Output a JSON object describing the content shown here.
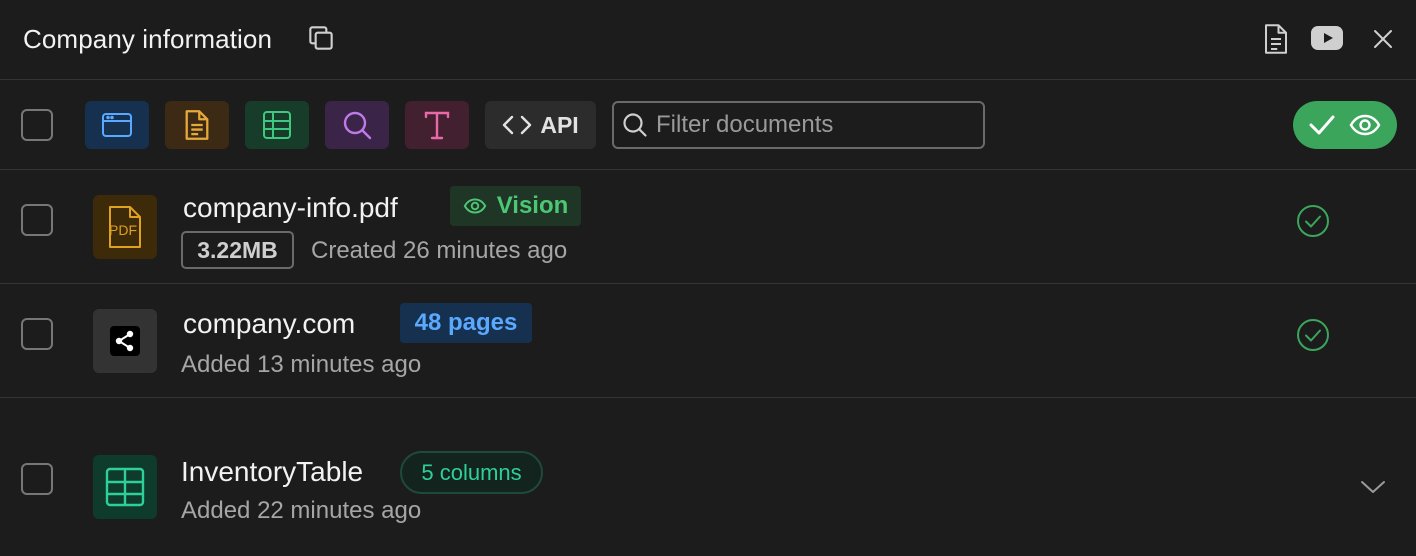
{
  "header": {
    "title": "Company information",
    "icons": [
      "copy-icon",
      "document-icon",
      "youtube-icon",
      "close-icon"
    ]
  },
  "toolbar": {
    "type_filters": [
      "browser-icon",
      "document-icon",
      "table-icon",
      "search-icon",
      "text-icon"
    ],
    "api_label": "API",
    "search_placeholder": "Filter documents",
    "approve_icons": [
      "check-icon",
      "eye-icon"
    ]
  },
  "documents": [
    {
      "name": "company-info.pdf",
      "icon": "pdf-icon",
      "icon_label": "PDF",
      "badge": "Vision",
      "size": "3.22MB",
      "meta": "Created 26 minutes ago",
      "status": "check-circle-icon"
    },
    {
      "name": "company.com",
      "icon": "share-icon",
      "badge": "48 pages",
      "meta": "Added 13 minutes ago",
      "status": "check-circle-icon"
    },
    {
      "name": "InventoryTable",
      "icon": "table-icon",
      "badge": "5 columns",
      "meta": "Added 22 minutes ago",
      "status": "chevron-down-icon"
    }
  ],
  "colors": {
    "accent_green": "#3ba55c",
    "badge_blue": "#5aa9ff",
    "badge_teal": "#2fcf9a",
    "pdf_orange": "#e0a020"
  }
}
